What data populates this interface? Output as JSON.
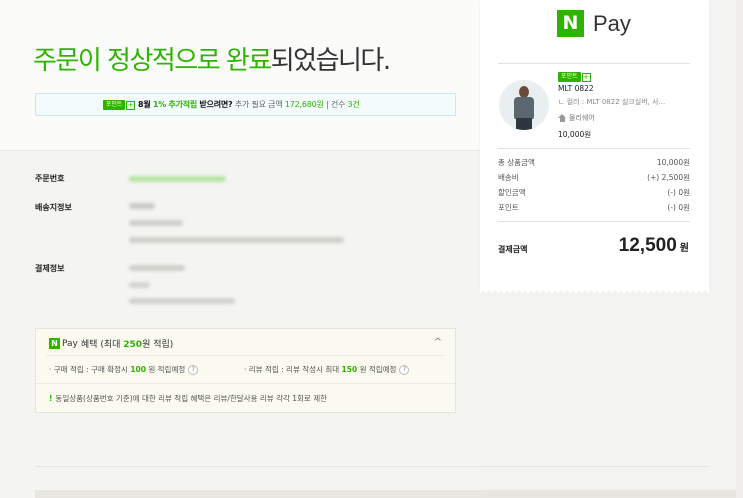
{
  "headline": {
    "green_part": "주문이 정상적으로 완료",
    "dark_part": "되었습니다."
  },
  "promo_banner": {
    "tag": "포인트",
    "tag_plus": "+",
    "month": "8월",
    "rate": "1%",
    "rate_text": "추가적립",
    "suffix": "받으려면?",
    "required_label": "추가 필요 금액",
    "required_amount": "172,680원",
    "divider": "|",
    "count_label": "건수",
    "count_value": "3건"
  },
  "order_info": {
    "order_number_label": "주문번호",
    "shipping_label": "배송지정보",
    "payment_label": "결제정보"
  },
  "benefit_box": {
    "logo_letter": "N",
    "logo_text": "Pay",
    "title": "혜택",
    "max_prefix": "(최대",
    "max_value": "250",
    "max_suffix": "원 적립)",
    "collapse_icon": "^",
    "purchase_label": "· 구매 적립 : 구매 확정시",
    "purchase_value": "100",
    "purchase_suffix": "원 적립예정",
    "review_label": "· 리뷰 적립 : 리뷰 작성시 최대",
    "review_value": "150",
    "review_suffix": "원 적립예정",
    "help_glyph": "?",
    "note_mark": "!",
    "note_text": "동일상품(상품번호 기준)에 대한 리뷰 적립 혜택은 리뷰/한달사용 리뷰 각각 1회로 제한"
  },
  "receipt": {
    "logo_letter": "N",
    "logo_text": "Pay",
    "product": {
      "tag": "포인트",
      "tag_plus": "+",
      "name": "MLT 0822",
      "option": "ㄴ 컬러 : MLT 0822 실크실버, 사...",
      "shop": "몰리쉐어",
      "price": "10,000원"
    },
    "summary": [
      {
        "label": "총 상품금액",
        "value": "10,000원"
      },
      {
        "label": "배송비",
        "value": "(+) 2,500원"
      },
      {
        "label": "할인금액",
        "value": "(-) 0원"
      },
      {
        "label": "포인트",
        "value": "(-) 0원"
      }
    ],
    "total_label": "결제금액",
    "total_value": "12,500",
    "total_unit": "원"
  },
  "colors": {
    "accent": "#2db400",
    "text_dark": "#333333",
    "banner_border": "#cfe7ec"
  }
}
